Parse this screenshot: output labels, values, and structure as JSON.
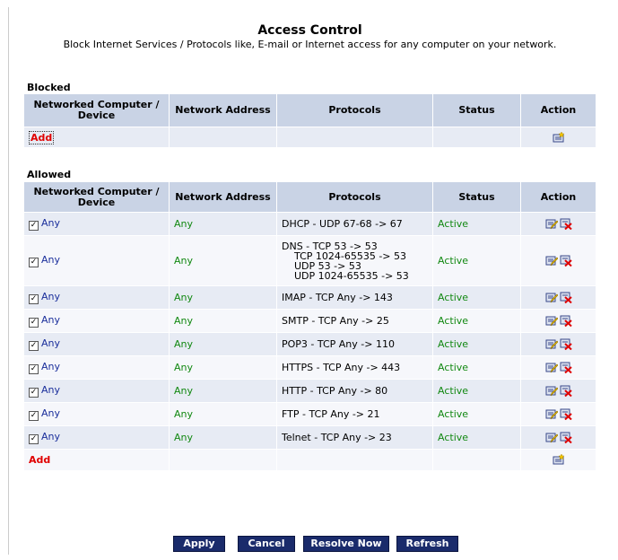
{
  "header": {
    "title": "Access Control",
    "subtitle": "Block Internet Services / Protocols like, E-mail or Internet access for any computer on your network."
  },
  "columns": {
    "device": "Networked Computer / Device",
    "address": "Network Address",
    "protocols": "Protocols",
    "status": "Status",
    "action": "Action"
  },
  "blocked": {
    "label": "Blocked",
    "add_label": "Add"
  },
  "allowed": {
    "label": "Allowed",
    "add_label": "Add",
    "rows": [
      {
        "device": "Any",
        "address": "Any",
        "protocol": "DHCP - UDP 67-68 -> 67",
        "status": "Active"
      },
      {
        "device": "Any",
        "address": "Any",
        "protocol_lines": [
          "DNS - TCP 53 -> 53",
          "TCP 1024-65535 -> 53",
          "UDP 53 -> 53",
          "UDP 1024-65535 -> 53"
        ],
        "status": "Active"
      },
      {
        "device": "Any",
        "address": "Any",
        "protocol": "IMAP - TCP Any -> 143",
        "status": "Active"
      },
      {
        "device": "Any",
        "address": "Any",
        "protocol": "SMTP - TCP Any -> 25",
        "status": "Active"
      },
      {
        "device": "Any",
        "address": "Any",
        "protocol": "POP3 - TCP Any -> 110",
        "status": "Active"
      },
      {
        "device": "Any",
        "address": "Any",
        "protocol": "HTTPS - TCP Any -> 443",
        "status": "Active"
      },
      {
        "device": "Any",
        "address": "Any",
        "protocol": "HTTP - TCP Any -> 80",
        "status": "Active"
      },
      {
        "device": "Any",
        "address": "Any",
        "protocol": "FTP - TCP Any -> 21",
        "status": "Active"
      },
      {
        "device": "Any",
        "address": "Any",
        "protocol": "Telnet - TCP Any -> 23",
        "status": "Active"
      }
    ]
  },
  "buttons": {
    "apply": "Apply",
    "cancel": "Cancel",
    "resolve_now": "Resolve Now",
    "refresh": "Refresh"
  },
  "icons": {
    "row_actions": [
      "edit-icon",
      "delete-icon"
    ],
    "add_action": "new-entry-icon"
  },
  "colors": {
    "header_bg": "#c9d3e5",
    "row_alt_bg": "#e7ebf4",
    "active_text": "#118811",
    "add_link": "#e00000",
    "button_bg": "#1a2b6b"
  }
}
